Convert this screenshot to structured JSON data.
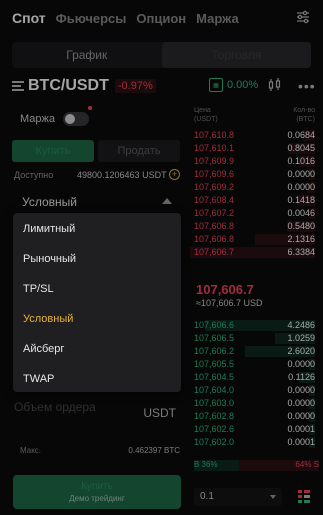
{
  "topnav": {
    "tabs": [
      "Спот",
      "Фьючерсы",
      "Опцион",
      "Маржа"
    ],
    "active_index": 0
  },
  "subtabs": {
    "items": [
      "График",
      "Торговля"
    ],
    "active_index": 1
  },
  "pair": {
    "symbol": "BTC/USDT",
    "change": "-0.97%",
    "ticker_change": "0.00%"
  },
  "trade": {
    "margin_label": "Маржа",
    "buy_label": "Купить",
    "sell_label": "Продать",
    "available_label": "Доступно",
    "available_value": "49800.1206463 USDT",
    "order_type": "Условный",
    "volume_placeholder": "Объем ордера",
    "volume_unit": "USDT",
    "max_label": "Макс.",
    "max_value": "0.462397 BTC",
    "buy_button_label": "Купить",
    "buy_button_sub": "Демо трейдинг"
  },
  "dropdown": {
    "options": [
      "Лимитный",
      "Рыночный",
      "TP/SL",
      "Условный",
      "Айсберг",
      "TWAP"
    ],
    "selected_index": 3
  },
  "orderbook": {
    "price_header_1": "Цена",
    "price_header_2": "(USDT)",
    "qty_header_1": "Кол-во",
    "qty_header_2": "(BTC)",
    "asks": [
      {
        "price": "107,610.8",
        "qty": "0.0684"
      },
      {
        "price": "107,610.1",
        "qty": "0.8045"
      },
      {
        "price": "107,609.9",
        "qty": "0.1016"
      },
      {
        "price": "107,609.6",
        "qty": "0.0000"
      },
      {
        "price": "107,609.2",
        "qty": "0.0000"
      },
      {
        "price": "107,608.4",
        "qty": "0.1418"
      },
      {
        "price": "107,607.2",
        "qty": "0.0046"
      },
      {
        "price": "107,606.8",
        "qty": "0.5480"
      },
      {
        "price": "107,606.8",
        "qty": "2.1316"
      },
      {
        "price": "107,606.7",
        "qty": "6.3384"
      }
    ],
    "mid_price": "107,606.7",
    "mid_usd": "≈107,606.7 USD",
    "bids": [
      {
        "price": "107,606.6",
        "qty": "4.2486"
      },
      {
        "price": "107,606.5",
        "qty": "1.0259"
      },
      {
        "price": "107,606.2",
        "qty": "2.6020"
      },
      {
        "price": "107,605.5",
        "qty": "0.0000"
      },
      {
        "price": "107,604.5",
        "qty": "0.1126"
      },
      {
        "price": "107,604.0",
        "qty": "0.0000"
      },
      {
        "price": "107,603.0",
        "qty": "0.0000"
      },
      {
        "price": "107,602.8",
        "qty": "0.0000"
      },
      {
        "price": "107,602.6",
        "qty": "0.0001"
      },
      {
        "price": "107,602.0",
        "qty": "0.0001"
      }
    ],
    "buy_ratio_label": "B 36%",
    "sell_ratio_label": "64% S",
    "buy_ratio": 0.36,
    "depth": "0.1"
  },
  "colors": {
    "accent_yellow": "#e5b23a",
    "green": "#2ebd85",
    "red": "#f6465d"
  }
}
